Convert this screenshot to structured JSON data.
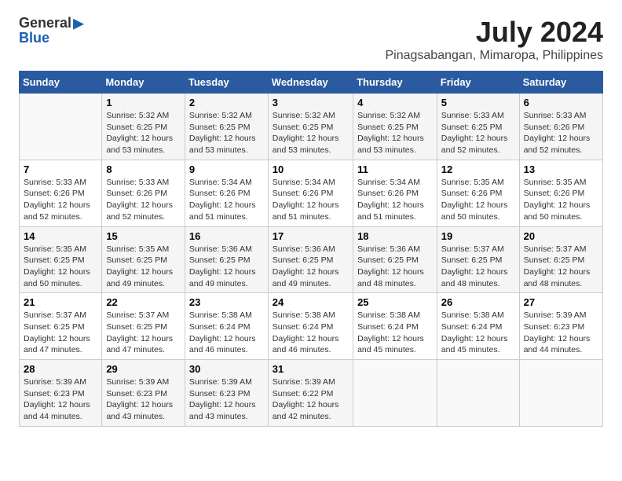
{
  "header": {
    "logo_general": "General",
    "logo_blue": "Blue",
    "title": "July 2024",
    "subtitle": "Pinagsabangan, Mimaropa, Philippines"
  },
  "calendar": {
    "days_of_week": [
      "Sunday",
      "Monday",
      "Tuesday",
      "Wednesday",
      "Thursday",
      "Friday",
      "Saturday"
    ],
    "weeks": [
      [
        {
          "day": "",
          "info": ""
        },
        {
          "day": "1",
          "info": "Sunrise: 5:32 AM\nSunset: 6:25 PM\nDaylight: 12 hours\nand 53 minutes."
        },
        {
          "day": "2",
          "info": "Sunrise: 5:32 AM\nSunset: 6:25 PM\nDaylight: 12 hours\nand 53 minutes."
        },
        {
          "day": "3",
          "info": "Sunrise: 5:32 AM\nSunset: 6:25 PM\nDaylight: 12 hours\nand 53 minutes."
        },
        {
          "day": "4",
          "info": "Sunrise: 5:32 AM\nSunset: 6:25 PM\nDaylight: 12 hours\nand 53 minutes."
        },
        {
          "day": "5",
          "info": "Sunrise: 5:33 AM\nSunset: 6:25 PM\nDaylight: 12 hours\nand 52 minutes."
        },
        {
          "day": "6",
          "info": "Sunrise: 5:33 AM\nSunset: 6:26 PM\nDaylight: 12 hours\nand 52 minutes."
        }
      ],
      [
        {
          "day": "7",
          "info": "Sunrise: 5:33 AM\nSunset: 6:26 PM\nDaylight: 12 hours\nand 52 minutes."
        },
        {
          "day": "8",
          "info": "Sunrise: 5:33 AM\nSunset: 6:26 PM\nDaylight: 12 hours\nand 52 minutes."
        },
        {
          "day": "9",
          "info": "Sunrise: 5:34 AM\nSunset: 6:26 PM\nDaylight: 12 hours\nand 51 minutes."
        },
        {
          "day": "10",
          "info": "Sunrise: 5:34 AM\nSunset: 6:26 PM\nDaylight: 12 hours\nand 51 minutes."
        },
        {
          "day": "11",
          "info": "Sunrise: 5:34 AM\nSunset: 6:26 PM\nDaylight: 12 hours\nand 51 minutes."
        },
        {
          "day": "12",
          "info": "Sunrise: 5:35 AM\nSunset: 6:26 PM\nDaylight: 12 hours\nand 50 minutes."
        },
        {
          "day": "13",
          "info": "Sunrise: 5:35 AM\nSunset: 6:26 PM\nDaylight: 12 hours\nand 50 minutes."
        }
      ],
      [
        {
          "day": "14",
          "info": "Sunrise: 5:35 AM\nSunset: 6:25 PM\nDaylight: 12 hours\nand 50 minutes."
        },
        {
          "day": "15",
          "info": "Sunrise: 5:35 AM\nSunset: 6:25 PM\nDaylight: 12 hours\nand 49 minutes."
        },
        {
          "day": "16",
          "info": "Sunrise: 5:36 AM\nSunset: 6:25 PM\nDaylight: 12 hours\nand 49 minutes."
        },
        {
          "day": "17",
          "info": "Sunrise: 5:36 AM\nSunset: 6:25 PM\nDaylight: 12 hours\nand 49 minutes."
        },
        {
          "day": "18",
          "info": "Sunrise: 5:36 AM\nSunset: 6:25 PM\nDaylight: 12 hours\nand 48 minutes."
        },
        {
          "day": "19",
          "info": "Sunrise: 5:37 AM\nSunset: 6:25 PM\nDaylight: 12 hours\nand 48 minutes."
        },
        {
          "day": "20",
          "info": "Sunrise: 5:37 AM\nSunset: 6:25 PM\nDaylight: 12 hours\nand 48 minutes."
        }
      ],
      [
        {
          "day": "21",
          "info": "Sunrise: 5:37 AM\nSunset: 6:25 PM\nDaylight: 12 hours\nand 47 minutes."
        },
        {
          "day": "22",
          "info": "Sunrise: 5:37 AM\nSunset: 6:25 PM\nDaylight: 12 hours\nand 47 minutes."
        },
        {
          "day": "23",
          "info": "Sunrise: 5:38 AM\nSunset: 6:24 PM\nDaylight: 12 hours\nand 46 minutes."
        },
        {
          "day": "24",
          "info": "Sunrise: 5:38 AM\nSunset: 6:24 PM\nDaylight: 12 hours\nand 46 minutes."
        },
        {
          "day": "25",
          "info": "Sunrise: 5:38 AM\nSunset: 6:24 PM\nDaylight: 12 hours\nand 45 minutes."
        },
        {
          "day": "26",
          "info": "Sunrise: 5:38 AM\nSunset: 6:24 PM\nDaylight: 12 hours\nand 45 minutes."
        },
        {
          "day": "27",
          "info": "Sunrise: 5:39 AM\nSunset: 6:23 PM\nDaylight: 12 hours\nand 44 minutes."
        }
      ],
      [
        {
          "day": "28",
          "info": "Sunrise: 5:39 AM\nSunset: 6:23 PM\nDaylight: 12 hours\nand 44 minutes."
        },
        {
          "day": "29",
          "info": "Sunrise: 5:39 AM\nSunset: 6:23 PM\nDaylight: 12 hours\nand 43 minutes."
        },
        {
          "day": "30",
          "info": "Sunrise: 5:39 AM\nSunset: 6:23 PM\nDaylight: 12 hours\nand 43 minutes."
        },
        {
          "day": "31",
          "info": "Sunrise: 5:39 AM\nSunset: 6:22 PM\nDaylight: 12 hours\nand 42 minutes."
        },
        {
          "day": "",
          "info": ""
        },
        {
          "day": "",
          "info": ""
        },
        {
          "day": "",
          "info": ""
        }
      ]
    ]
  }
}
